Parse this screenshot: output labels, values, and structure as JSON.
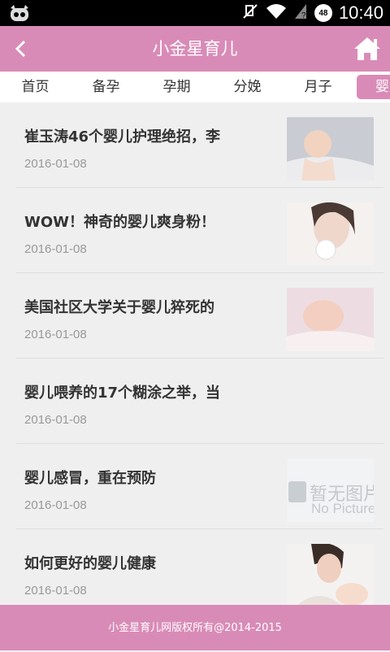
{
  "status": {
    "time": "10:40",
    "battery_level": "48"
  },
  "header": {
    "title": "小金星育儿"
  },
  "tabs": [
    {
      "label": "首页"
    },
    {
      "label": "备孕"
    },
    {
      "label": "孕期"
    },
    {
      "label": "分娩"
    },
    {
      "label": "月子"
    },
    {
      "label": "婴儿"
    }
  ],
  "articles": [
    {
      "title": "崔玉涛46个婴儿护理绝招，李",
      "date": "2016-01-08",
      "thumb": "baby-in-blanket-photo"
    },
    {
      "title": "WOW！神奇的婴儿爽身粉！",
      "date": "2016-01-08",
      "thumb": "woman-with-powder-puff-photo"
    },
    {
      "title": "美国社区大学关于婴儿猝死的",
      "date": "2016-01-08",
      "thumb": "smiling-baby-photo"
    },
    {
      "title": "婴儿喂养的17个糊涂之举，当",
      "date": "2016-01-08",
      "thumb": ""
    },
    {
      "title": "婴儿感冒，重在预防",
      "date": "2016-01-08",
      "thumb": "no-picture-placeholder",
      "placeholder_cn": "暂无图片",
      "placeholder_en": "No Picture"
    },
    {
      "title": "如何更好的婴儿健康",
      "date": "2016-01-08",
      "thumb": "mother-and-baby-photo"
    }
  ],
  "footer": {
    "copyright": "小金星育儿网版权所有@2014-2015"
  },
  "colors": {
    "accent": "#d98bb7",
    "background": "#efeff0"
  }
}
